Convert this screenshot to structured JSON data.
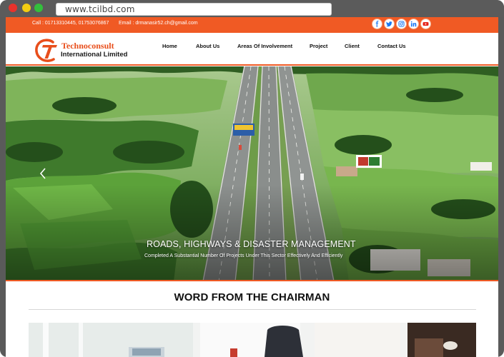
{
  "browser": {
    "url": "www.tcilbd.com"
  },
  "topbar": {
    "call": "Call : 01713310445, 01753076867",
    "email": "Email : drmanasir52.ch@gmail.com",
    "social": [
      "facebook-icon",
      "twitter-icon",
      "instagram-icon",
      "linkedin-icon",
      "youtube-icon"
    ]
  },
  "logo": {
    "line1": "Technoconsult",
    "line2": "International Limited"
  },
  "nav": {
    "items": [
      "Home",
      "About Us",
      "Areas Of Involvement",
      "Project",
      "Client",
      "Contact Us"
    ]
  },
  "hero": {
    "title": "ROADS, HIGHWAYS & DISASTER MANAGEMENT",
    "subtitle": "Completed A Substantial Number Of Projects Under This Sector Effectively And Efficiently"
  },
  "section": {
    "title": "WORD FROM THE CHAIRMAN"
  },
  "colors": {
    "accent": "#f05a24",
    "social_blue": "#1877f2"
  }
}
